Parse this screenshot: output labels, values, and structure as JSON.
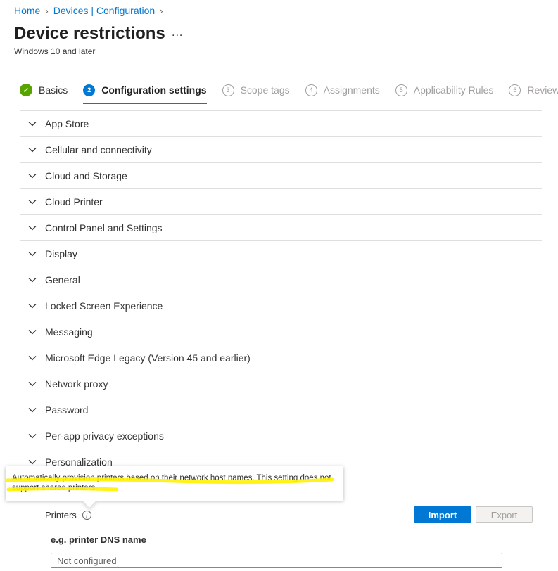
{
  "breadcrumb": {
    "items": [
      "Home",
      "Devices | Configuration"
    ]
  },
  "header": {
    "title": "Device restrictions",
    "more": "...",
    "subtitle": "Windows 10 and later"
  },
  "wizard": {
    "steps": [
      {
        "num": "✓",
        "label": "Basics",
        "state": "done"
      },
      {
        "num": "2",
        "label": "Configuration settings",
        "state": "current"
      },
      {
        "num": "3",
        "label": "Scope tags",
        "state": "future"
      },
      {
        "num": "4",
        "label": "Assignments",
        "state": "future"
      },
      {
        "num": "5",
        "label": "Applicability Rules",
        "state": "future"
      },
      {
        "num": "6",
        "label": "Review",
        "state": "future"
      }
    ]
  },
  "accordion": {
    "items": [
      "App Store",
      "Cellular and connectivity",
      "Cloud and Storage",
      "Cloud Printer",
      "Control Panel and Settings",
      "Display",
      "General",
      "Locked Screen Experience",
      "Messaging",
      "Microsoft Edge Legacy (Version 45 and earlier)",
      "Network proxy",
      "Password",
      "Per-app privacy exceptions",
      "Personalization"
    ]
  },
  "tooltip": {
    "text": "Automatically provision printers based on their network host names. This setting does not support shared printers."
  },
  "printers": {
    "label": "Printers",
    "info": "i",
    "import_label": "Import",
    "export_label": "Export",
    "column_header": "e.g. printer DNS name",
    "input_placeholder": "Not configured"
  },
  "colors": {
    "accent": "#0078d4",
    "success": "#57a300",
    "highlight": "#fff200"
  }
}
